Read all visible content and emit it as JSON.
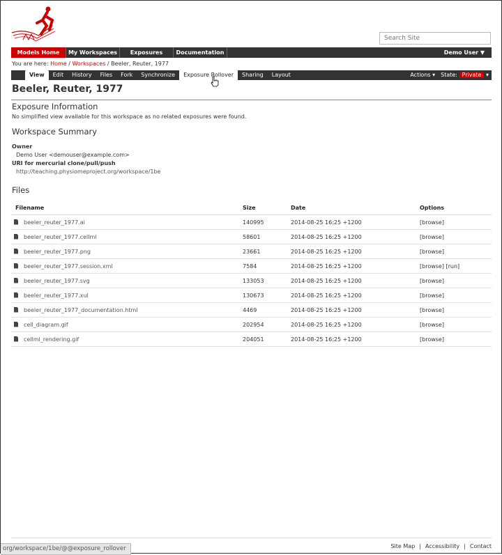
{
  "search": {
    "placeholder": "Search Site"
  },
  "topnav": {
    "items": [
      {
        "label": "Models Home"
      },
      {
        "label": "My Workspaces"
      },
      {
        "label": "Exposures"
      },
      {
        "label": "Documentation"
      }
    ],
    "user": "Demo User ▼"
  },
  "breadcrumb": {
    "prefix": "You are here: ",
    "home": "Home",
    "sep": " / ",
    "workspaces": "Workspaces",
    "current": "Beeler, Reuter, 1977"
  },
  "subnav": {
    "tabs": [
      "View",
      "Edit",
      "History",
      "Files",
      "Fork",
      "Synchronize",
      "Exposure Rollover",
      "Sharing",
      "Layout"
    ],
    "actions": "Actions ▾",
    "state_label": "State:",
    "state_value": "Private",
    "state_arrow": "▾"
  },
  "page": {
    "title": "Beeler, Reuter, 1977",
    "exposure_heading": "Exposure Information",
    "exposure_text": "No simplified view available for this workspace as no related exposures were found.",
    "summary_heading": "Workspace Summary",
    "owner_label": "Owner",
    "owner_value": "Demo User <demouser@example.com>",
    "uri_label": "URI for mercurial clone/pull/push",
    "uri_value": "http://teaching.physiomeproject.org/workspace/1be",
    "files_heading": "Files"
  },
  "files": {
    "headers": {
      "filename": "Filename",
      "size": "Size",
      "date": "Date",
      "options": "Options"
    },
    "rows": [
      {
        "name": "beeler_reuter_1977.ai",
        "size": "140995",
        "date": "2014-08-25 16:25 +1200",
        "options": "[browse]"
      },
      {
        "name": "beeler_reuter_1977.cellml",
        "size": "58601",
        "date": "2014-08-25 16:25 +1200",
        "options": "[browse]"
      },
      {
        "name": "beeler_reuter_1977.png",
        "size": "23661",
        "date": "2014-08-25 16:25 +1200",
        "options": "[browse]"
      },
      {
        "name": "beeler_reuter_1977.session.xml",
        "size": "7584",
        "date": "2014-08-25 16:25 +1200",
        "options": "[browse] [run]"
      },
      {
        "name": "beeler_reuter_1977.svg",
        "size": "133053",
        "date": "2014-08-25 16:25 +1200",
        "options": "[browse]"
      },
      {
        "name": "beeler_reuter_1977.xul",
        "size": "130673",
        "date": "2014-08-25 16:25 +1200",
        "options": "[browse]"
      },
      {
        "name": "beeler_reuter_1977_documentation.html",
        "size": "4469",
        "date": "2014-08-25 16:25 +1200",
        "options": "[browse]"
      },
      {
        "name": "cell_diagram.gif",
        "size": "202954",
        "date": "2014-08-25 16:25 +1200",
        "options": "[browse]"
      },
      {
        "name": "cellml_rendering.gif",
        "size": "204051",
        "date": "2014-08-25 16:25 +1200",
        "options": "[browse]"
      }
    ]
  },
  "footer": {
    "links": [
      "Site Map",
      "Accessibility",
      "Contact"
    ],
    "sep": "|"
  },
  "statusbar": {
    "url": "org/workspace/1be/@@exposure_rollover"
  },
  "colors": {
    "accent": "#cc0000",
    "nav_bg": "#333333"
  }
}
